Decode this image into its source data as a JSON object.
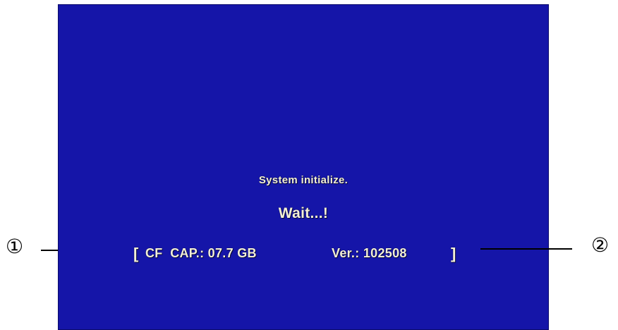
{
  "screen": {
    "status": "System initialize.",
    "wait": "Wait...!",
    "bracket_open": "[",
    "bracket_close": "]",
    "cf_capacity": "CF  CAP.: 07.7 GB",
    "version": "Ver.: 102508"
  },
  "callouts": [
    "①",
    "②"
  ],
  "colors": {
    "screen_background": "#1515a8",
    "screen_text": "#f2efd8",
    "annotation": "#000000"
  }
}
